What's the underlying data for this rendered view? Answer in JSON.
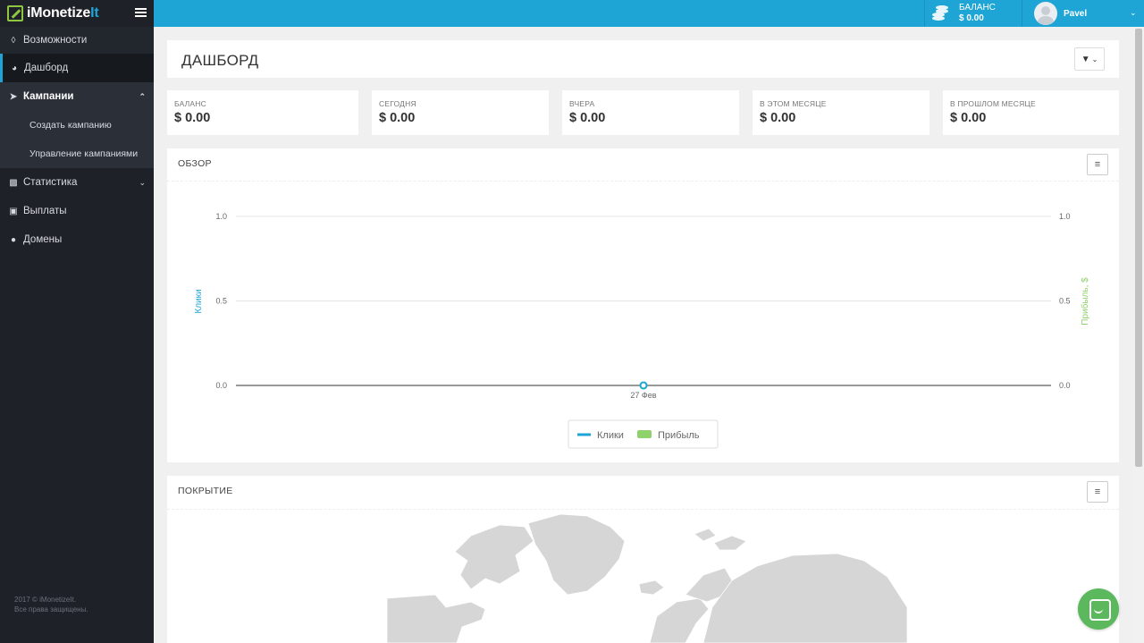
{
  "app": {
    "logo_main": "iMonetize",
    "logo_accent": "It"
  },
  "sidebar": {
    "items": [
      {
        "label": "Возможности",
        "icon": "lightbulb-icon"
      },
      {
        "label": "Дашборд",
        "icon": "dashboard-icon"
      },
      {
        "label": "Кампании",
        "icon": "paper-plane-icon"
      },
      {
        "label": "Статистика",
        "icon": "bar-chart-icon"
      },
      {
        "label": "Выплаты",
        "icon": "money-icon"
      },
      {
        "label": "Домены",
        "icon": "globe-icon"
      }
    ],
    "sub_items": [
      "Создать кампанию",
      "Управление кампаниями"
    ],
    "footer_line1": "2017 © iMonetizeIt.",
    "footer_line2": "Все права защищены."
  },
  "topbar": {
    "balance_label": "БАЛАНС",
    "balance_value": "$ 0.00",
    "username": "Pavel"
  },
  "page": {
    "title": "ДАШБОРД"
  },
  "stats": [
    {
      "label": "БАЛАНС",
      "value": "$ 0.00"
    },
    {
      "label": "СЕГОДНЯ",
      "value": "$ 0.00"
    },
    {
      "label": "ВЧЕРА",
      "value": "$ 0.00"
    },
    {
      "label": "В ЭТОМ МЕСЯЦЕ",
      "value": "$ 0.00"
    },
    {
      "label": "В ПРОШЛОМ МЕСЯЦЕ",
      "value": "$ 0.00"
    }
  ],
  "overview": {
    "title": "ОБЗОР"
  },
  "coverage": {
    "title": "ПОКРЫТИЕ"
  },
  "colors": {
    "accent": "#1ea5d6",
    "sidebar": "#1e2128",
    "profit": "#8fd16a",
    "clicks": "#1ea5d6"
  },
  "chart_data": {
    "type": "line",
    "x": [
      "27 Фев"
    ],
    "series": [
      {
        "name": "Клики",
        "values": [
          0
        ],
        "axis": "left",
        "color": "#1ea5d6"
      },
      {
        "name": "Прибыль",
        "values": [
          0
        ],
        "axis": "right",
        "color": "#8fd16a"
      }
    ],
    "ylabel": "Клики",
    "ylabel_right": "Прибыль, $",
    "ylim": [
      0,
      1
    ],
    "yticks": [
      "0.0",
      "0.5",
      "1.0"
    ],
    "grid": true,
    "legend": "bottom-center"
  }
}
